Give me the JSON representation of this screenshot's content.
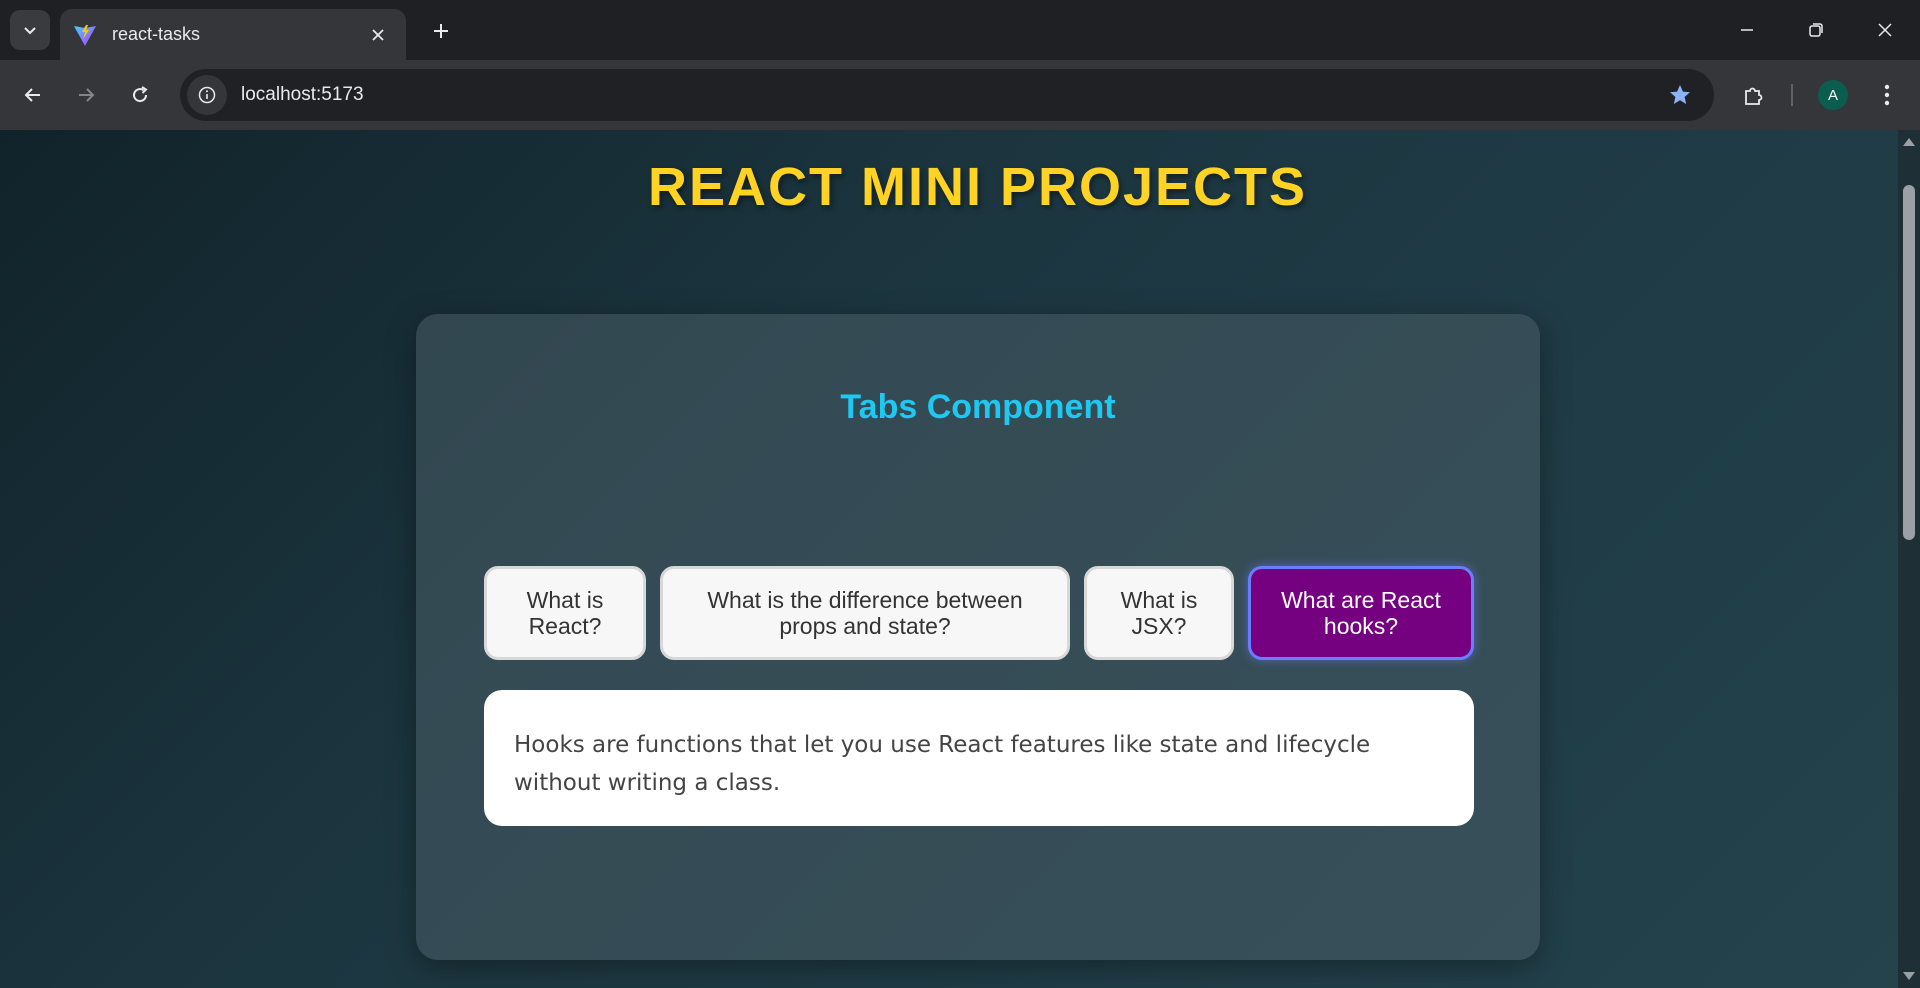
{
  "browser": {
    "tab_title": "react-tasks",
    "url": "localhost:5173",
    "profile_initial": "A"
  },
  "page": {
    "title": "REACT MINI PROJECTS"
  },
  "card": {
    "title": "Tabs Component",
    "tabs": [
      {
        "label": "What is React?",
        "active": false
      },
      {
        "label": "What is the difference between props and state?",
        "active": false
      },
      {
        "label": "What is JSX?",
        "active": false
      },
      {
        "label": "What are React hooks?",
        "active": true
      }
    ],
    "content": "Hooks are functions that let you use React features like state and lifecycle without writing a class."
  },
  "colors": {
    "title_yellow": "#ffd324",
    "card_title_cyan": "#1ec8f0",
    "active_tab_bg": "#750080",
    "active_tab_border": "#6b7dff"
  }
}
